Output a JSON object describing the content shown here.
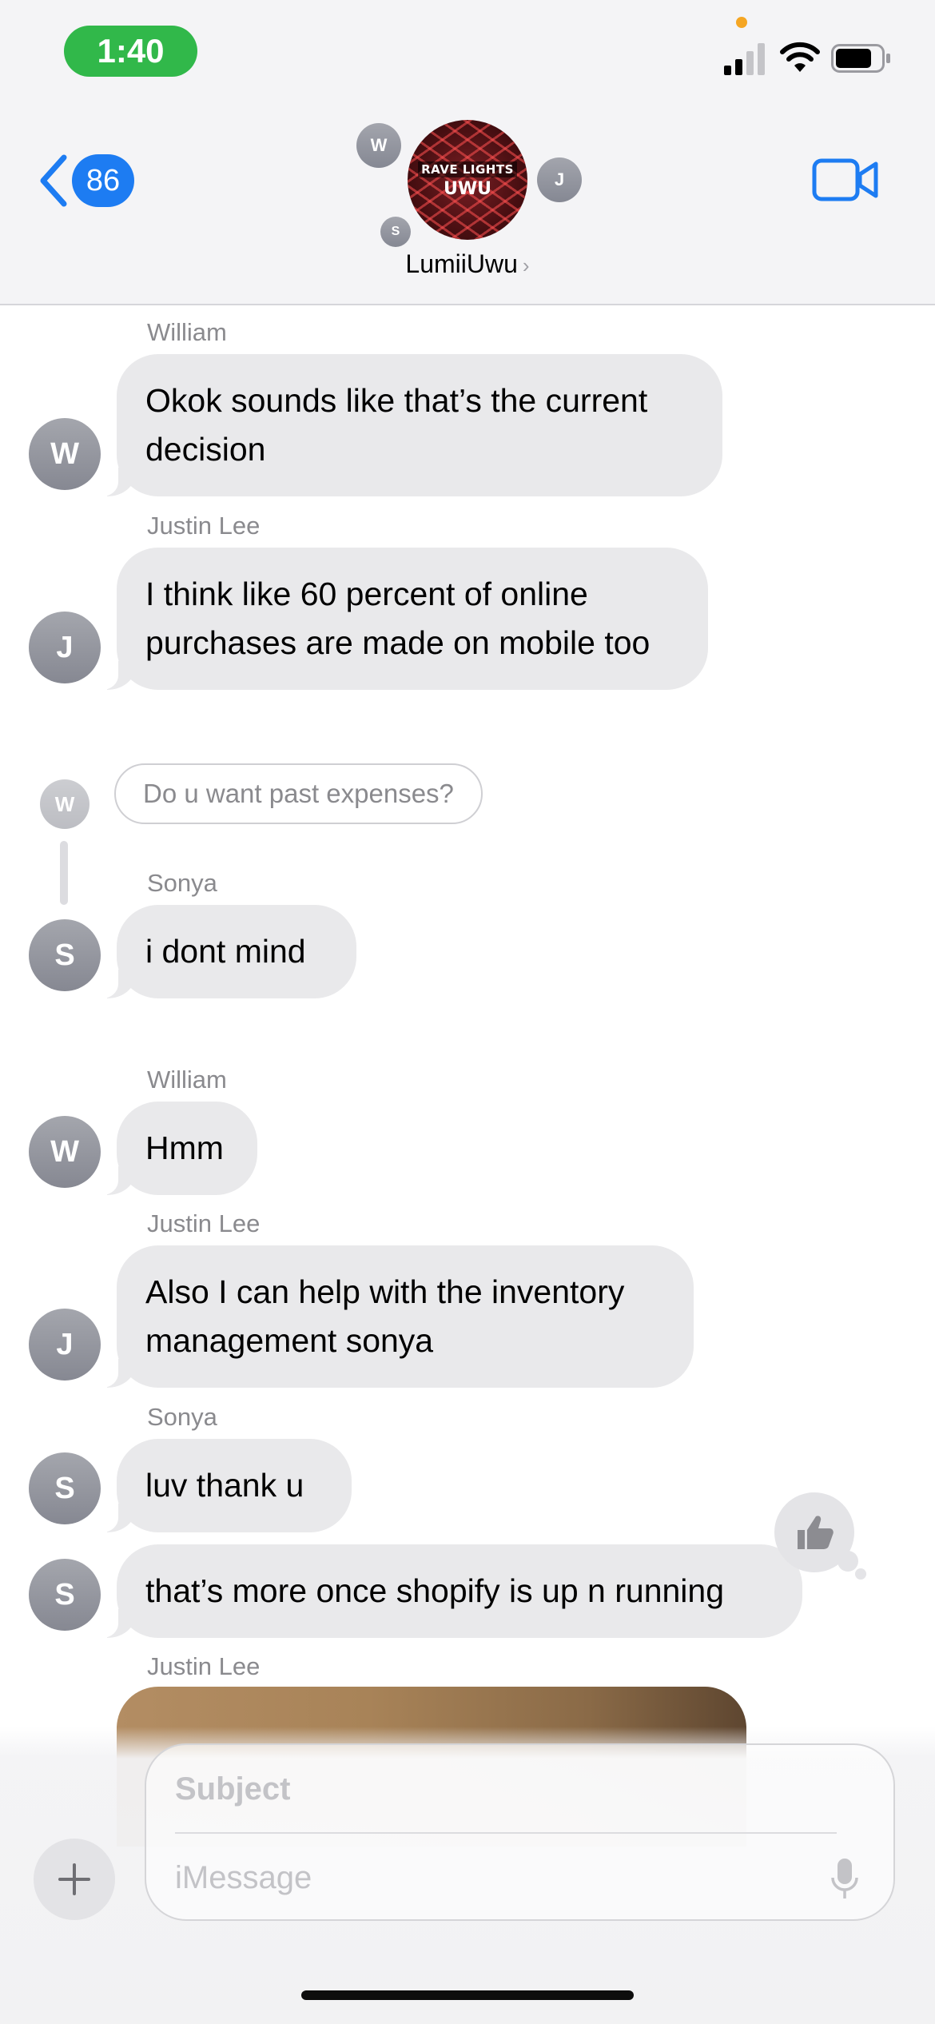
{
  "status_bar": {
    "time": "1:40",
    "accent_color": "#31b84a"
  },
  "header": {
    "back_count": "86",
    "group_name": "LumiiUwu",
    "group_avatar_text_1": "RAVE LIGHTS",
    "group_avatar_text_2": "UWU",
    "members": [
      "W",
      "J",
      "S"
    ],
    "accent_color": "#1d7cf2"
  },
  "messages": [
    {
      "sender": "William",
      "initial": "W",
      "text_lines": [
        "Okok sounds like that’s the current",
        "decision"
      ]
    },
    {
      "sender": "Justin Lee",
      "initial": "J",
      "text_lines": [
        "I think like 60 percent of online",
        "purchases are made on mobile too"
      ]
    },
    {
      "reply_to_initial": "W",
      "reply_to_text": "Do u want past expenses?"
    },
    {
      "sender": "Sonya",
      "initial": "S",
      "text_lines": [
        "i dont mind"
      ]
    },
    {
      "sender": "William",
      "initial": "W",
      "text_lines": [
        "Hmm"
      ]
    },
    {
      "sender": "Justin Lee",
      "initial": "J",
      "text_lines": [
        "Also I can help with the inventory",
        "management sonya"
      ]
    },
    {
      "sender": "Sonya",
      "initial": "S",
      "text_lines": [
        "luv thank u"
      ]
    },
    {
      "initial": "S",
      "text_lines": [
        "that’s more once shopify is up n running"
      ],
      "tapback": "thumbs-up"
    },
    {
      "sender": "Justin Lee",
      "attachment": "image"
    }
  ],
  "composer": {
    "subject_placeholder": "Subject",
    "message_placeholder": "iMessage"
  }
}
